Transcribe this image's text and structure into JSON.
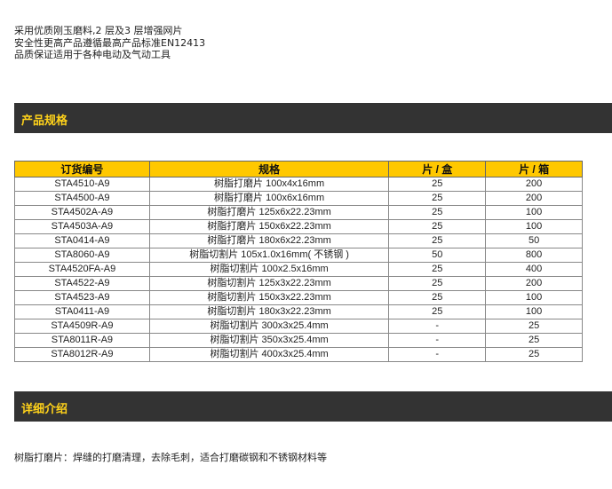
{
  "intro": [
    "采用优质刚玉磨料,2 层及3 层增强网片",
    "安全性更高产品遵循最高产品标准EN12413",
    "品质保证适用于各种电动及气动工具"
  ],
  "sections": {
    "spec_title": "产品规格",
    "detail_title": "详细介绍"
  },
  "table": {
    "headers": [
      "订货编号",
      "规格",
      "片 / 盒",
      "片 / 箱"
    ],
    "rows": [
      [
        "STA4510-A9",
        "树脂打磨片 100x4x16mm",
        "25",
        "200"
      ],
      [
        "STA4500-A9",
        "树脂打磨片 100x6x16mm",
        "25",
        "200"
      ],
      [
        "STA4502A-A9",
        "树脂打磨片 125x6x22.23mm",
        "25",
        "100"
      ],
      [
        "STA4503A-A9",
        "树脂打磨片 150x6x22.23mm",
        "25",
        "100"
      ],
      [
        "STA0414-A9",
        "树脂打磨片 180x6x22.23mm",
        "25",
        "50"
      ],
      [
        "STA8060-A9",
        "树脂切割片 105x1.0x16mm( 不锈钢 )",
        "50",
        "800"
      ],
      [
        "STA4520FA-A9",
        "树脂切割片 100x2.5x16mm",
        "25",
        "400"
      ],
      [
        "STA4522-A9",
        "树脂切割片 125x3x22.23mm",
        "25",
        "200"
      ],
      [
        "STA4523-A9",
        "树脂切割片 150x3x22.23mm",
        "25",
        "100"
      ],
      [
        "STA0411-A9",
        "树脂切割片 180x3x22.23mm",
        "25",
        "100"
      ],
      [
        "STA4509R-A9",
        "树脂切割片 300x3x25.4mm",
        "-",
        "25"
      ],
      [
        "STA8011R-A9",
        "树脂切割片 350x3x25.4mm",
        "-",
        "25"
      ],
      [
        "STA8012R-A9",
        "树脂切割片 400x3x25.4mm",
        "-",
        "25"
      ]
    ]
  },
  "detail_text": "树脂打磨片：焊缝的打磨清理，去除毛刺，适合打磨碳钢和不锈钢材料等",
  "colors": {
    "bar_background": "#333333",
    "bar_title": "#ffd21a",
    "header_background": "#ffc800"
  }
}
